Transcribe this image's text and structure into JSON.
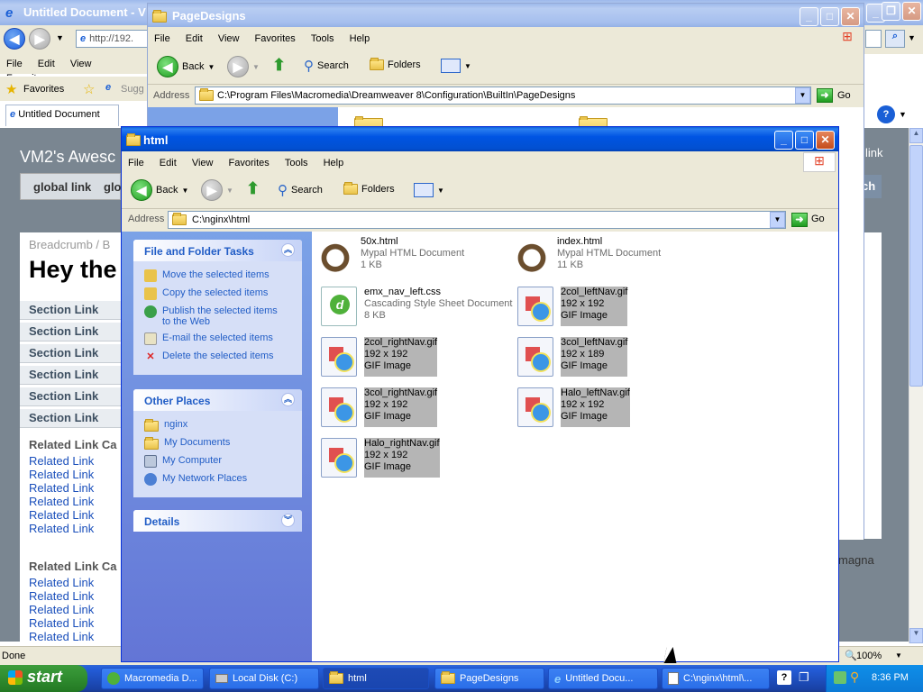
{
  "ie": {
    "title": "Untitled Document - V",
    "address": "http://192.",
    "menus": [
      "File",
      "Edit",
      "View",
      "Favorites"
    ],
    "favorites_label": "Favorites",
    "sugg": "Sugg",
    "tab": "Untitled Document",
    "status": "Done",
    "zoom": "100%",
    "page": {
      "heading_site": "VM2's Awesc",
      "global_links": [
        "global link",
        "glo"
      ],
      "right_link": "link",
      "right_link2": "ch",
      "breadcrumb": "Breadcrumb / B",
      "hey": "Hey the",
      "sections": [
        "Section Link",
        "Section Link",
        "Section Link",
        "Section Link",
        "Section Link",
        "Section Link"
      ],
      "cat1": "Related Link Ca",
      "related1": [
        "Related Link",
        "Related Link",
        "Related Link",
        "Related Link",
        "Related Link",
        "Related Link"
      ],
      "cat2": "Related Link Ca",
      "related2": [
        "Related Link",
        "Related Link",
        "Related Link",
        "Related Link",
        "Related Link"
      ],
      "magna": "magna"
    }
  },
  "pagedesigns": {
    "title": "PageDesigns",
    "menus": [
      "File",
      "Edit",
      "View",
      "Favorites",
      "Tools",
      "Help"
    ],
    "back": "Back",
    "search": "Search",
    "folders": "Folders",
    "address_label": "Address",
    "address": "C:\\Program Files\\Macromedia\\Dreamweaver 8\\Configuration\\BuiltIn\\PageDesigns",
    "go": "Go",
    "panel_cut": "File and Folder Tasks"
  },
  "html": {
    "title": "html",
    "menus": [
      "File",
      "Edit",
      "View",
      "Favorites",
      "Tools",
      "Help"
    ],
    "back": "Back",
    "search": "Search",
    "folders": "Folders",
    "address_label": "Address",
    "address": "C:\\nginx\\html",
    "go": "Go",
    "tasks_header": "File and Folder Tasks",
    "tasks": [
      "Move the selected items",
      "Copy the selected items",
      "Publish the selected items to the Web",
      "E-mail the selected items",
      "Delete the selected items"
    ],
    "places_header": "Other Places",
    "places": [
      "nginx",
      "My Documents",
      "My Computer",
      "My Network Places"
    ],
    "details_header": "Details",
    "files": [
      {
        "name": "50x.html",
        "type": "Mypal HTML Document",
        "size": "1 KB"
      },
      {
        "name": "index.html",
        "type": "Mypal HTML Document",
        "size": "11 KB"
      },
      {
        "name": "emx_nav_left.css",
        "type": "Cascading Style Sheet Document",
        "size": "8 KB"
      },
      {
        "name": "2col_leftNav.gif",
        "type": "192 x 192",
        "size": "GIF Image"
      },
      {
        "name": "2col_rightNav.gif",
        "type": "192 x 192",
        "size": "GIF Image"
      },
      {
        "name": "3col_leftNav.gif",
        "type": "192 x 189",
        "size": "GIF Image"
      },
      {
        "name": "3col_rightNav.gif",
        "type": "192 x 192",
        "size": "GIF Image"
      },
      {
        "name": "Halo_leftNav.gif",
        "type": "192 x 192",
        "size": "GIF Image"
      },
      {
        "name": "Halo_rightNav.gif",
        "type": "192 x 192",
        "size": "GIF Image"
      }
    ]
  },
  "taskbar": {
    "start": "start",
    "tasks": [
      "Macromedia D...",
      "Local Disk (C:)",
      "html",
      "PageDesigns",
      "Untitled Docu...",
      "C:\\nginx\\html\\..."
    ],
    "clock": "8:36 PM"
  }
}
